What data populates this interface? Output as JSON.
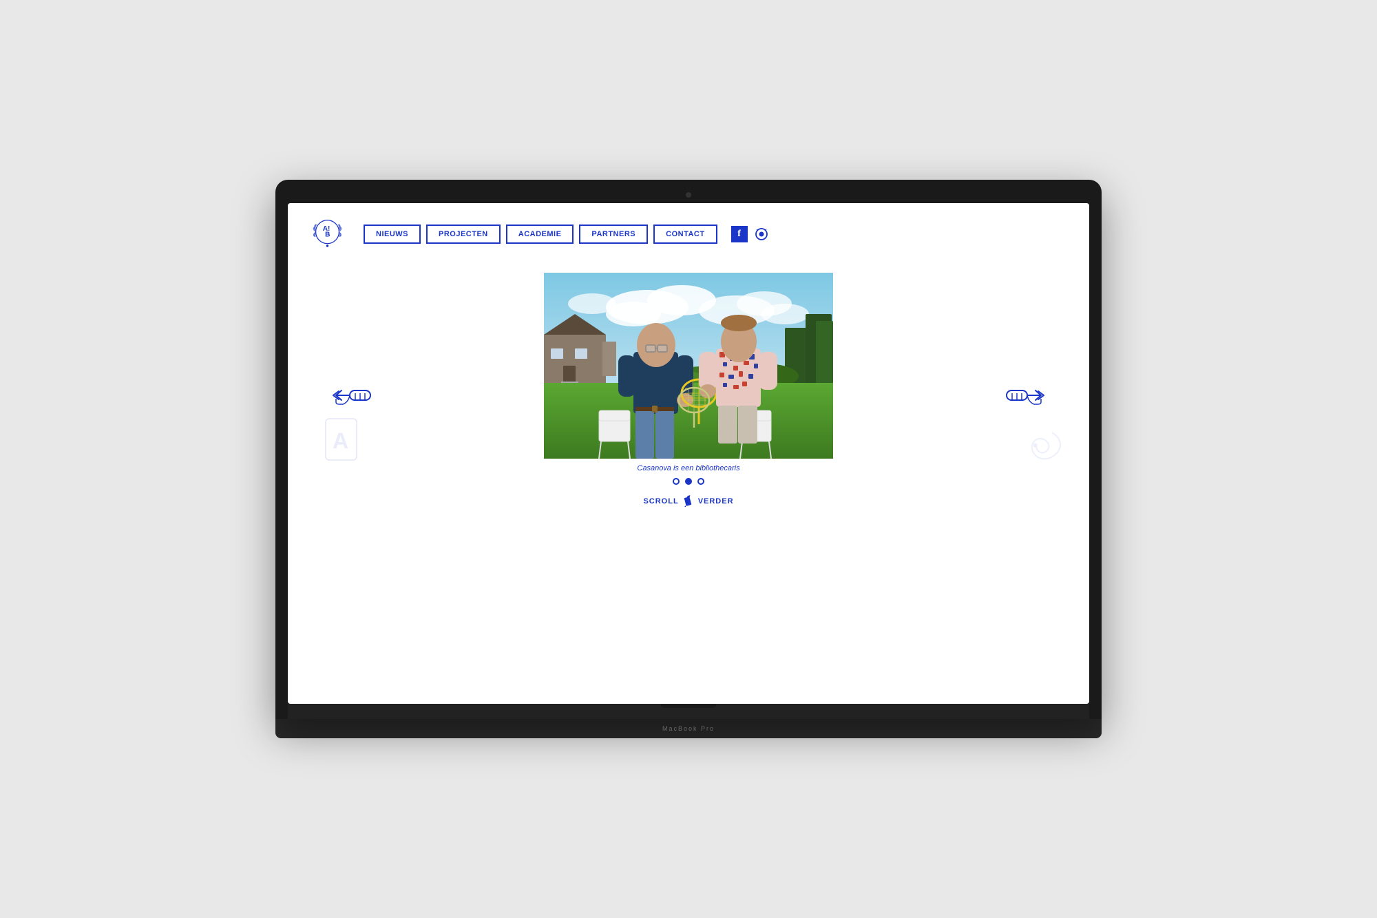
{
  "laptop": {
    "model_label": "MacBook Pro"
  },
  "nav": {
    "logo_alt": "AB Logo",
    "buttons": [
      {
        "label": "NIEUWS",
        "id": "nieuws"
      },
      {
        "label": "PROJECTEN",
        "id": "projecten"
      },
      {
        "label": "ACADEMIE",
        "id": "academie"
      },
      {
        "label": "PARTNERS",
        "id": "partners"
      },
      {
        "label": "CONTACT",
        "id": "contact"
      }
    ],
    "facebook_label": "f",
    "eye_icon": "👁"
  },
  "hero": {
    "caption": "Casanova is een bibliothecaris",
    "dots": [
      {
        "active": false
      },
      {
        "active": true
      },
      {
        "active": false
      }
    ]
  },
  "scroll": {
    "label": "SCROLL",
    "verder": "VERDER"
  },
  "arrows": {
    "left_title": "left arrow hand",
    "right_title": "right arrow hand"
  }
}
